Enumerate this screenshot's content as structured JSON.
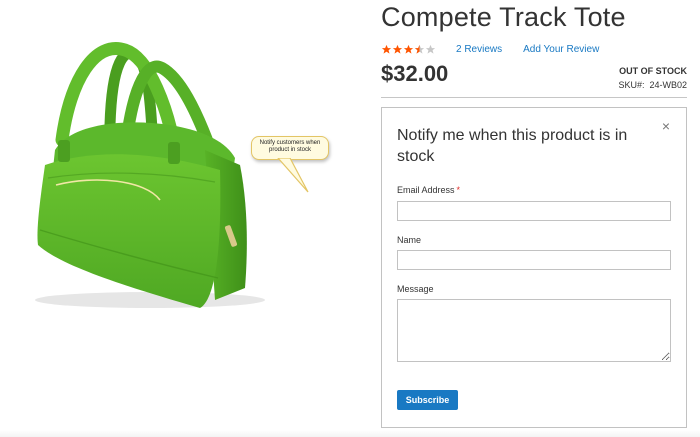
{
  "product": {
    "name": "Compete Track Tote",
    "rating_fraction": 0.7,
    "reviews_label": "2 Reviews",
    "add_review_label": "Add Your Review",
    "price": "$32.00",
    "stock_status": "OUT OF STOCK",
    "sku_label": "SKU#:",
    "sku_value": "24-WB02",
    "image_icon": "green-tote-bag-image"
  },
  "tooltip": {
    "text": "Notify customers when product in stock"
  },
  "notify_form": {
    "title": "Notify me when this product is in stock",
    "close_symbol": "×",
    "email_label": "Email Address",
    "required_mark": "*",
    "name_label": "Name",
    "message_label": "Message",
    "email_value": "",
    "name_value": "",
    "message_value": "",
    "submit_label": "Subscribe"
  },
  "colors": {
    "accent_link": "#1979c3",
    "button": "#1979c3",
    "star_filled": "#ff5501",
    "star_empty": "#c7c7c7",
    "required": "#e02b27",
    "bag_green": "#5cb82c"
  }
}
